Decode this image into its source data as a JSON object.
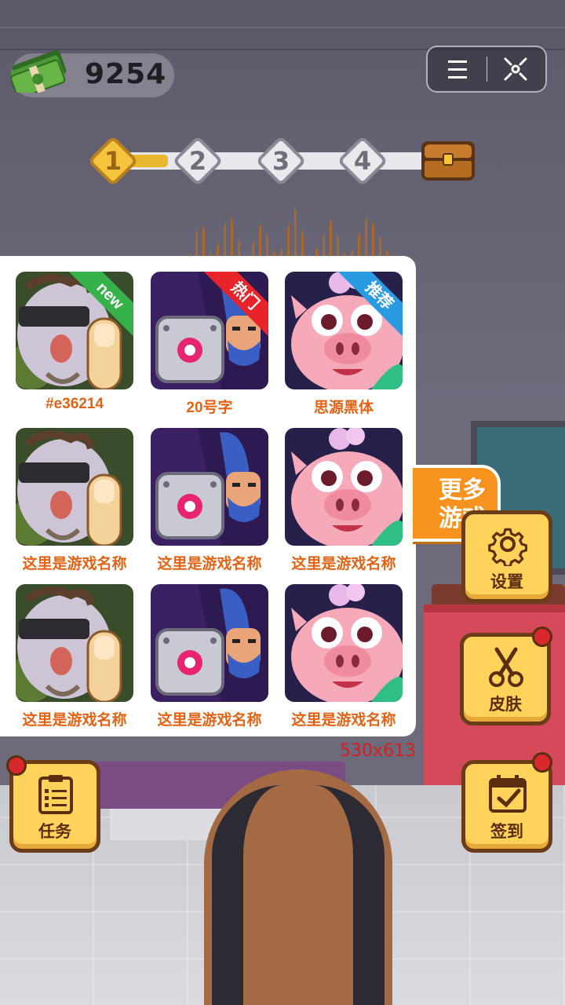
{
  "coins": {
    "value": "9254"
  },
  "progress": {
    "steps": [
      "1",
      "2",
      "3",
      "4"
    ],
    "current_step": 1
  },
  "games": [
    {
      "name": "#e36214",
      "badge": "new",
      "art": "zombie"
    },
    {
      "name": "20号字",
      "badge": "热门",
      "art": "robot"
    },
    {
      "name": "思源黑体",
      "badge": "推荐",
      "art": "pig"
    },
    {
      "name": "这里是游戏名称",
      "badge": "",
      "art": "zombie"
    },
    {
      "name": "这里是游戏名称",
      "badge": "",
      "art": "robot"
    },
    {
      "name": "这里是游戏名称",
      "badge": "",
      "art": "pig"
    },
    {
      "name": "这里是游戏名称",
      "badge": "",
      "art": "zombie"
    },
    {
      "name": "这里是游戏名称",
      "badge": "",
      "art": "robot"
    },
    {
      "name": "这里是游戏名称",
      "badge": "",
      "art": "pig"
    }
  ],
  "size_label": "530x613",
  "more_games": {
    "line1": "更多",
    "line2": "游戏"
  },
  "side_buttons": {
    "settings": {
      "label": "设置",
      "icon": "gear-icon"
    },
    "skins": {
      "label": "皮肤",
      "icon": "scissors-icon"
    },
    "checkin": {
      "label": "签到",
      "icon": "calendar-check-icon"
    },
    "tasks": {
      "label": "任务",
      "icon": "clipboard-list-icon"
    }
  },
  "colors": {
    "accent_orange": "#f7921e",
    "name_orange": "#e36214",
    "button_yellow": "#ffd35a",
    "badge_red": "#d8282b"
  }
}
